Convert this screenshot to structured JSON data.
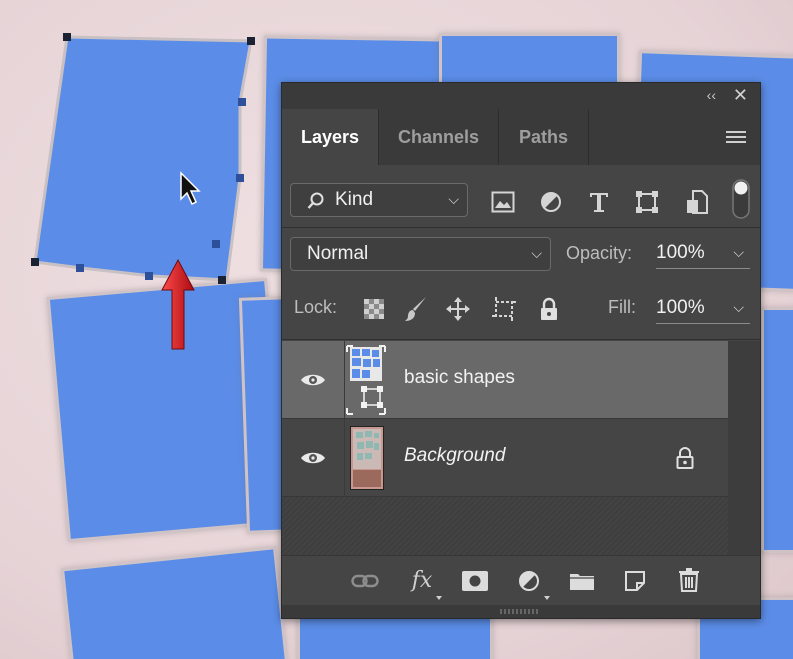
{
  "panel": {
    "tabs": [
      "Layers",
      "Channels",
      "Paths"
    ],
    "collapse_glyph": "‹‹",
    "close_glyph": "✕"
  },
  "filter": {
    "label": "Kind"
  },
  "blend": {
    "mode": "Normal",
    "opacity_label": "Opacity:",
    "opacity_value": "100%"
  },
  "lock": {
    "label": "Lock:",
    "fill_label": "Fill:",
    "fill_value": "100%"
  },
  "layers": [
    {
      "name": "basic shapes",
      "visible": true,
      "selected": true,
      "kind": "smart-object"
    },
    {
      "name": "Background",
      "visible": true,
      "selected": false,
      "locked": true
    }
  ],
  "bottom_bar": {
    "fx_label": "fx"
  },
  "colors": {
    "shape_fill": "#5b8de8",
    "panel_bg": "#454545",
    "arrow": "#d0121b"
  },
  "icons": [
    "search-icon",
    "image-filter-icon",
    "adjustment-filter-icon",
    "type-filter-icon",
    "shape-filter-icon",
    "smart-object-filter-icon",
    "filter-toggle-icon",
    "lock-transparency-icon",
    "lock-image-icon",
    "lock-position-icon",
    "lock-artboard-icon",
    "lock-all-icon",
    "eye-icon",
    "lock-icon",
    "link-icon",
    "mask-icon",
    "adjustment-layer-icon",
    "folder-icon",
    "new-layer-icon",
    "trash-icon",
    "cursor-icon",
    "up-arrow-icon"
  ]
}
